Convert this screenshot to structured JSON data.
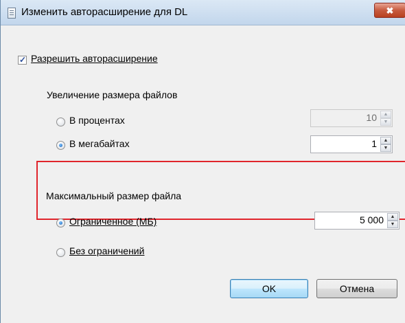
{
  "window": {
    "title": "Изменить авторасширение для DL",
    "close_symbol": "✖"
  },
  "autogrowth": {
    "checkbox_label": "Разрешить авторасширение",
    "checked": true
  },
  "file_growth": {
    "section_label": "Увеличение размера файлов",
    "percent_label": "В процентах",
    "percent_value": "10",
    "percent_selected": false,
    "mb_label": "В мегабайтах",
    "mb_value": "1",
    "mb_selected": true
  },
  "max_size": {
    "section_label": "Максимальный размер файла",
    "limited_label": "Ограниченное (МБ)",
    "limited_value": "5 000",
    "limited_selected": true,
    "unlimited_label": "Без ограничений",
    "unlimited_selected": false
  },
  "buttons": {
    "ok_label": "OK",
    "cancel_label": "Отмена"
  },
  "icons": {
    "window": "document-icon",
    "close": "close-icon",
    "spin_up": "spin-up-arrow-icon",
    "spin_down": "spin-down-arrow-icon"
  },
  "colors": {
    "highlight_box": "#e0242b",
    "close_button": "#c75b3f",
    "default_button_border": "#3c7fb1"
  }
}
